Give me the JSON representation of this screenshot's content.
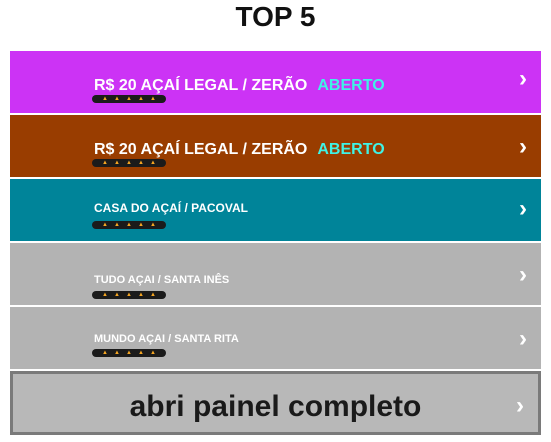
{
  "title": "TOP 5",
  "items": [
    {
      "label": "R$ 20 AÇAÍ LEGAL / ZERÃO",
      "status": "ABERTO",
      "color": "#cc33f5"
    },
    {
      "label": "R$ 20 AÇAÍ LEGAL / ZERÃO",
      "status": "ABERTO",
      "color": "#993d00"
    },
    {
      "label": "CASA DO AÇAÍ / PACOVAL",
      "status": "",
      "color": "#008499"
    },
    {
      "label": "TUDO AÇAI / SANTA INÊS",
      "status": "",
      "color": "#b3b3b3"
    },
    {
      "label": "MUNDO AÇAI  / SANTA RITA",
      "status": "",
      "color": "#b3b3b3"
    }
  ],
  "chevron": "›",
  "cta": {
    "label": "abri painel completo",
    "color": "#b8b8b8"
  }
}
